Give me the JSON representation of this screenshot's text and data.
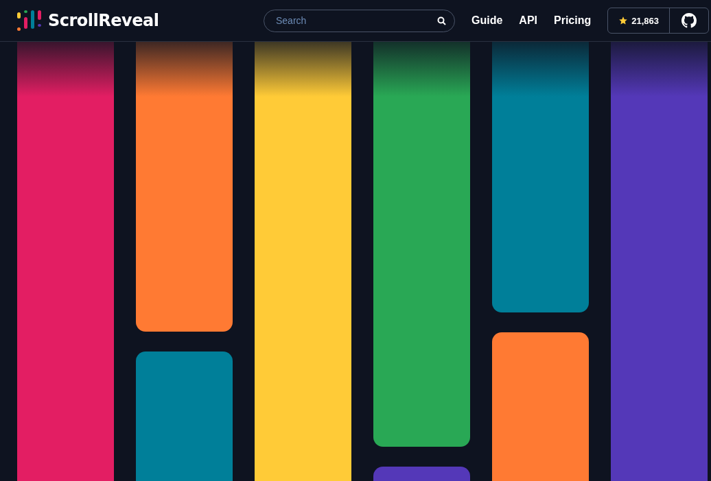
{
  "header": {
    "logo_text": "ScrollReveal",
    "search": {
      "placeholder": "Search"
    },
    "nav": [
      {
        "label": "Guide"
      },
      {
        "label": "API"
      },
      {
        "label": "Pricing"
      }
    ],
    "stars": "21,863"
  },
  "columns": [
    {
      "tiles": [
        {
          "color": "#e31e63"
        }
      ]
    },
    {
      "tiles": [
        {
          "color": "#ff7a33"
        },
        {
          "color": "#007f99"
        }
      ]
    },
    {
      "tiles": [
        {
          "color": "#ffcb37"
        }
      ]
    },
    {
      "tiles": [
        {
          "color": "#29a855"
        },
        {
          "color": "#5438b8"
        }
      ]
    },
    {
      "tiles": [
        {
          "color": "#007f99"
        },
        {
          "color": "#ff7a33"
        }
      ]
    },
    {
      "tiles": [
        {
          "color": "#5438b8"
        }
      ]
    }
  ]
}
